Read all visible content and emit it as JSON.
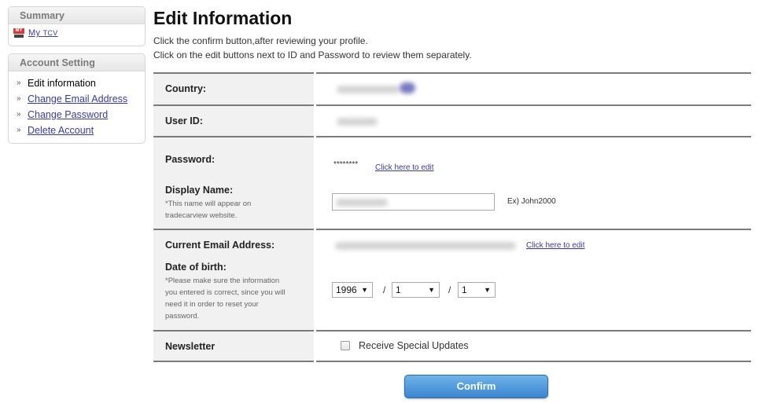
{
  "sidebar": {
    "summary": {
      "title": "Summary",
      "my_tcv_icon_text": "MY",
      "my_tcv_label": "My",
      "my_tcv_label_small": "TCV"
    },
    "account_setting": {
      "title": "Account Setting",
      "items": [
        {
          "label": "Edit information",
          "active": true
        },
        {
          "label": "Change Email Address",
          "active": false
        },
        {
          "label": "Change Password",
          "active": false
        },
        {
          "label": "Delete Account",
          "active": false
        }
      ],
      "bullet": "»"
    }
  },
  "main": {
    "title": "Edit Information",
    "description_line1": "Click the confirm button,after reviewing your profile.",
    "description_line2": "Click on the edit buttons next to ID and Password to review them separately.",
    "rows": {
      "country": {
        "label": "Country:"
      },
      "user_id": {
        "label": "User ID:"
      },
      "password": {
        "label": "Password:",
        "value": "********",
        "edit_link": "Click here to edit"
      },
      "display_name": {
        "label": "Display Name:",
        "note_line1": "*This name will appear on",
        "note_line2": "tradecarview website.",
        "example": "Ex) John2000"
      },
      "email": {
        "label": "Current Email Address:",
        "edit_link": "Click here to edit"
      },
      "dob": {
        "label": "Date of birth:",
        "note_line1": "*Please make sure the information",
        "note_line2": "you entered is correct, since you will",
        "note_line3": "need it in order to reset your",
        "note_line4": "password.",
        "year": "1996",
        "month": "1",
        "day": "1",
        "separator": "/",
        "arrow": "▼"
      },
      "newsletter": {
        "label": "Newsletter",
        "checkbox_label": "Receive Special Updates",
        "checked": false
      }
    },
    "confirm_label": "Confirm"
  }
}
